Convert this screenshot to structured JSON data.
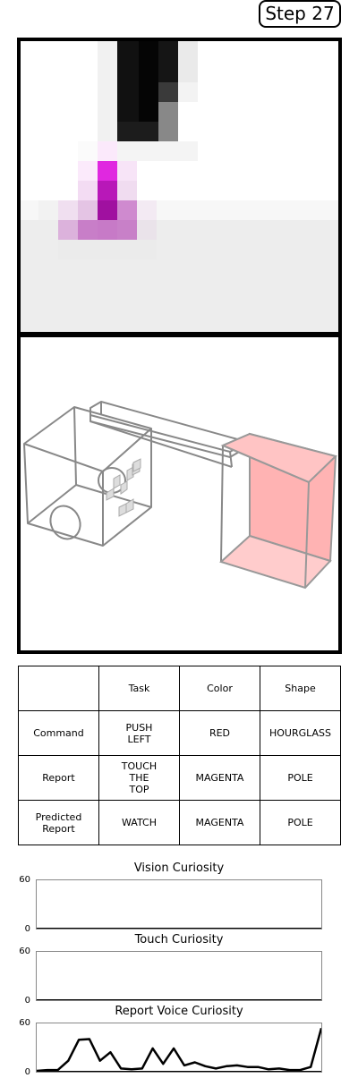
{
  "step_label": "Step 27",
  "table": {
    "headers": [
      "",
      "Task",
      "Color",
      "Shape"
    ],
    "rows": [
      {
        "label": "Command",
        "task": "PUSH\nLEFT",
        "color": "RED",
        "shape": "HOURGLASS"
      },
      {
        "label": "Report",
        "task": "TOUCH\nTHE\nTOP",
        "color": "MAGENTA",
        "shape": "POLE"
      },
      {
        "label": "Predicted\nReport",
        "task": "WATCH",
        "color": "MAGENTA",
        "shape": "POLE"
      }
    ]
  },
  "curiosity": [
    {
      "title": "Vision Curiosity",
      "ymax": "60",
      "ymin": "0",
      "values": []
    },
    {
      "title": "Touch Curiosity",
      "ymax": "60",
      "ymin": "0",
      "values": []
    },
    {
      "title": "Report Voice Curiosity",
      "ymax": "60",
      "ymin": "0",
      "values": [
        0,
        1,
        1,
        13,
        40,
        41,
        13,
        24,
        3,
        2,
        3,
        29,
        9,
        29,
        7,
        11,
        6,
        3,
        6,
        7,
        5,
        5,
        2,
        3,
        1,
        1,
        5,
        55
      ]
    }
  ],
  "colors": {
    "line": "#000000",
    "plot_border": "#888888",
    "target_box": "#ff9999",
    "gripper": "#cc00cc"
  },
  "icons": {
    "render": "3d-scene-render",
    "pixels": "pixel-camera-view"
  }
}
